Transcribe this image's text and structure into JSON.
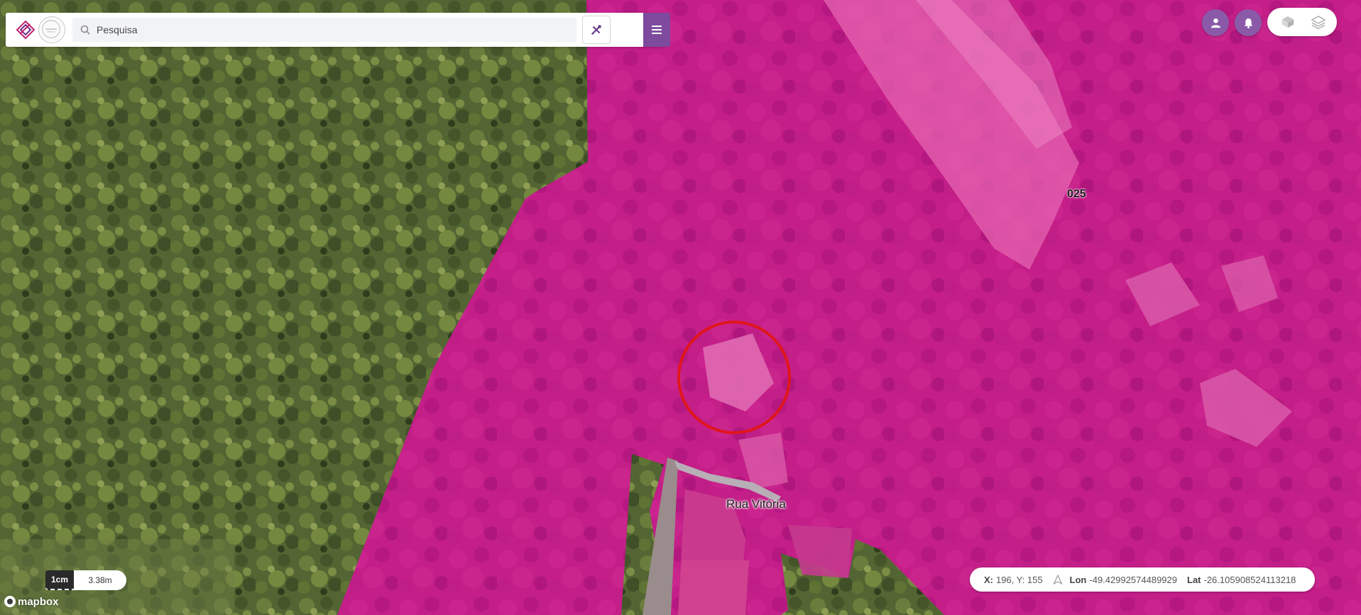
{
  "search": {
    "placeholder": "Pesquisa"
  },
  "map": {
    "labels": {
      "area_code": "025",
      "street_name": "Rua Vitória"
    },
    "highlight_color": "#d21e8e",
    "marker_color": "#e0161b"
  },
  "scale": {
    "unit_label": "1cm",
    "distance_label": "3.38m"
  },
  "attribution": {
    "logo_text": "mapbox"
  },
  "coords": {
    "xy_label": "X:",
    "xy_value": "196, Y: 155",
    "lon_label": "Lon",
    "lon_value": "-49.42992574489929",
    "lat_label": "Lat",
    "lat_value": "-26.105908524113218"
  },
  "icons": {
    "search": "search-icon",
    "tools": "tools-icon",
    "menu": "hamburger-menu-icon",
    "user": "user-icon",
    "notifications": "bell-icon",
    "layers_a": "layers-3d-icon",
    "layers_b": "layers-icon",
    "north": "north-arrow-icon"
  },
  "colors": {
    "accent_purple": "#7e4a9e",
    "round_button": "#8a5aa8"
  }
}
